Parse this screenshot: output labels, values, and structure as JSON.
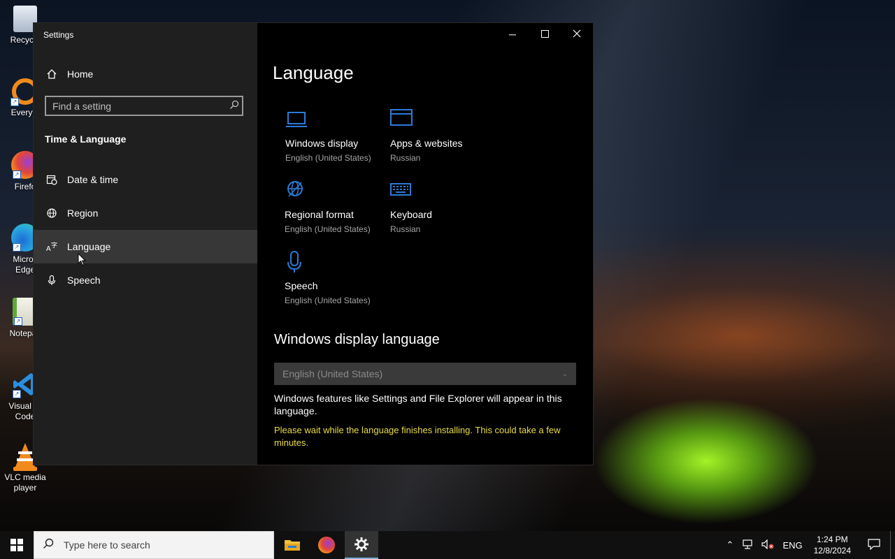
{
  "desktop": {
    "icons": [
      {
        "label": "Recycle",
        "icon": "recycle-bin-icon"
      },
      {
        "label": "Everyth",
        "icon": "everything-search-icon"
      },
      {
        "label": "Firefo",
        "icon": "firefox-icon"
      },
      {
        "label": "Micros\nEdge",
        "icon": "edge-icon"
      },
      {
        "label": "Notepac",
        "icon": "notepad-icon"
      },
      {
        "label": "Visual St\nCode",
        "icon": "vscode-icon"
      },
      {
        "label": "VLC media\nplayer",
        "icon": "vlc-icon"
      }
    ]
  },
  "window": {
    "title": "Settings",
    "sidebar": {
      "home_label": "Home",
      "search_placeholder": "Find a setting",
      "section_title": "Time & Language",
      "items": [
        {
          "label": "Date & time",
          "icon": "calendar-clock-icon",
          "active": false
        },
        {
          "label": "Region",
          "icon": "globe-icon",
          "active": false
        },
        {
          "label": "Language",
          "icon": "language-icon",
          "active": true
        },
        {
          "label": "Speech",
          "icon": "microphone-icon",
          "active": false
        }
      ]
    },
    "content": {
      "title": "Language",
      "tiles": [
        {
          "name": "Windows display",
          "value": "English (United States)",
          "icon": "laptop-icon"
        },
        {
          "name": "Apps & websites",
          "value": "Russian",
          "icon": "browser-window-icon"
        },
        {
          "name": "Regional format",
          "value": "English (United States)",
          "icon": "regional-format-icon"
        },
        {
          "name": "Keyboard",
          "value": "Russian",
          "icon": "keyboard-icon"
        },
        {
          "name": "Speech",
          "value": "English (United States)",
          "icon": "microphone-icon"
        }
      ],
      "display_language_title": "Windows display language",
      "display_language_value": "English (United States)",
      "description": "Windows features like Settings and File Explorer will appear in this language.",
      "warning": "Please wait while the language finishes installing. This could take a few minutes.",
      "accent_color": "#2d7ad6",
      "warning_color": "#e8dc4a"
    }
  },
  "taskbar": {
    "search_placeholder": "Type here to search",
    "language": "ENG",
    "time": "1:24 PM",
    "date": "12/8/2024"
  }
}
